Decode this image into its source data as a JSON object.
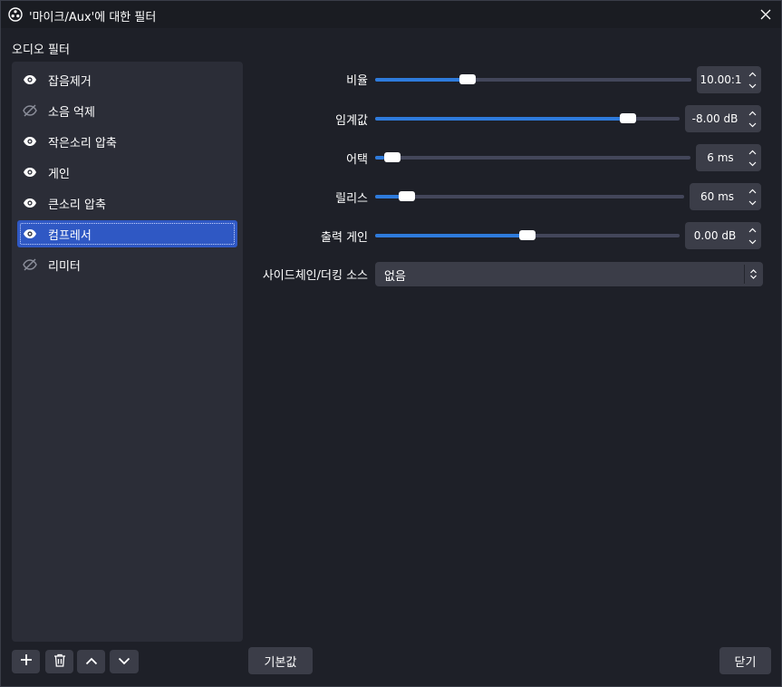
{
  "window": {
    "title": "'마이크/Aux'에 대한 필터",
    "app_icon": "obs-logo-icon",
    "close_icon": "close-icon"
  },
  "section_label": "오디오 필터",
  "filters": [
    {
      "label": "잡음제거",
      "enabled": true,
      "selected": false
    },
    {
      "label": "소음 억제",
      "enabled": false,
      "selected": false
    },
    {
      "label": "작은소리 압축",
      "enabled": true,
      "selected": false
    },
    {
      "label": "게인",
      "enabled": true,
      "selected": false
    },
    {
      "label": "큰소리 압축",
      "enabled": true,
      "selected": false
    },
    {
      "label": "컴프레서",
      "enabled": true,
      "selected": true
    },
    {
      "label": "리미터",
      "enabled": false,
      "selected": false
    }
  ],
  "properties": {
    "ratio": {
      "label": "비율",
      "value": "10.00:1",
      "fill_fraction": 0.28
    },
    "threshold": {
      "label": "임계값",
      "value": "-8.00 dB",
      "fill_fraction": 0.85
    },
    "attack": {
      "label": "어택",
      "value": "6 ms",
      "fill_fraction": 0.03
    },
    "release": {
      "label": "릴리스",
      "value": "60 ms",
      "fill_fraction": 0.08
    },
    "output_gain": {
      "label": "출력 게인",
      "value": "0.00 dB",
      "fill_fraction": 0.5
    },
    "sidechain": {
      "label": "사이드체인/더킹 소스",
      "value": "없음"
    }
  },
  "bottom_buttons": {
    "add_icon": "plus-icon",
    "remove_icon": "trash-icon",
    "move_up_icon": "chevron-up-icon",
    "move_down_icon": "chevron-down-icon",
    "defaults_label": "기본값",
    "close_label": "닫기"
  },
  "colors": {
    "accent": "#2e7bdc",
    "selection": "#2f58c4",
    "panel": "#2b2d37",
    "background": "#1e2028"
  }
}
